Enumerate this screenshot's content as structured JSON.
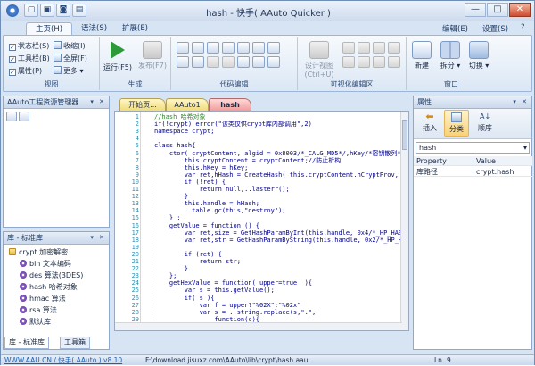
{
  "window": {
    "title": "hash - 快手( AAuto Quicker )",
    "min": "—",
    "max": "□",
    "close": "✕"
  },
  "ribbon_tabs": [
    "主页(H)",
    "语法(S)",
    "扩展(E)"
  ],
  "ribbon_menus": {
    "edit": "编辑(E)",
    "settings": "设置(S)",
    "help": "?"
  },
  "view_group": {
    "label": "视图",
    "items": [
      "状态栏(S)",
      "工具栏(B)",
      "属性(P)",
      "收缩(I)",
      "全屏(F)",
      "更多"
    ]
  },
  "generate_group": {
    "label": "生成",
    "run": "运行(F5)",
    "publish": "发布(F7)"
  },
  "code_group": {
    "label": "代码编辑"
  },
  "visual_group": {
    "label": "可视化编辑区",
    "design_view": "设计视图",
    "design_shortcut": "(Ctrl+U)"
  },
  "window_group": {
    "label": "窗口",
    "new": "新建",
    "split": "拆分",
    "switch": "切换"
  },
  "project_panel": {
    "title": "AAuto工程资源管理器"
  },
  "library_panel": {
    "title": "库 - 标准库",
    "items": [
      {
        "label": "crypt 加密解密",
        "kind": "dir"
      },
      {
        "label": "bin 文本编码",
        "kind": "mod"
      },
      {
        "label": "des 算法(3DES)",
        "kind": "mod"
      },
      {
        "label": "hash 哈希对象",
        "kind": "mod"
      },
      {
        "label": "hmac 算法",
        "kind": "mod"
      },
      {
        "label": "rsa 算法",
        "kind": "mod"
      },
      {
        "label": "默认库",
        "kind": "mod"
      }
    ]
  },
  "bottom_tabs": [
    "库 - 标准库",
    "工具箱"
  ],
  "editor_tabs": [
    "开始页...",
    "AAuto1",
    "hash"
  ],
  "code_lines": [
    {
      "n": "1",
      "t": "//hash 哈希对象"
    },
    {
      "n": "2",
      "t": "if(!crypt) error(\"该类仅供crypt库内部调用\",2)"
    },
    {
      "n": "3",
      "t": "namespace crypt;"
    },
    {
      "n": "4",
      "t": ""
    },
    {
      "n": "5",
      "t": "class hash{"
    },
    {
      "n": "6",
      "t": "    ctor( cryptContent, algid = 0x8003/*_CALG_MD5*/,hKey/*密钥散列*/,"
    },
    {
      "n": "7",
      "t": "        this.cryptContent = cryptContent;//防止析构"
    },
    {
      "n": "8",
      "t": "        this.hKey = hKey;"
    },
    {
      "n": "9",
      "t": "        var ret,hHash = CreateHash( this.cryptContent.hCryptProv, alg"
    },
    {
      "n": "10",
      "t": "        if (!ret) {"
    },
    {
      "n": "11",
      "t": "            return null,..lasterr();"
    },
    {
      "n": "12",
      "t": "        }"
    },
    {
      "n": "13",
      "t": "        this.handle = hHash;"
    },
    {
      "n": "14",
      "t": "        ..table.gc(this,\"destroy\");"
    },
    {
      "n": "15",
      "t": "    } ;"
    },
    {
      "n": "16",
      "t": "    getValue = function () {"
    },
    {
      "n": "17",
      "t": "        var ret,size = GetHashParamByInt(this.handle, 0x4/*_HP_HASHS"
    },
    {
      "n": "18",
      "t": "        var ret,str = GetHashParamByString(this.handle, 0x2/*_HP_HAS"
    },
    {
      "n": "19",
      "t": ""
    },
    {
      "n": "20",
      "t": "        if (ret) {"
    },
    {
      "n": "21",
      "t": "            return str;"
    },
    {
      "n": "22",
      "t": "        }"
    },
    {
      "n": "23",
      "t": "    };"
    },
    {
      "n": "24",
      "t": "    getHexValue = function( upper=true  ){"
    },
    {
      "n": "25",
      "t": "        var s = this.getValue();"
    },
    {
      "n": "26",
      "t": "        if( s ){"
    },
    {
      "n": "27",
      "t": "            var f = upper?\"%02X\":\"%02x\""
    },
    {
      "n": "28",
      "t": "            var s = ..string.replace(s,\".\","
    },
    {
      "n": "29",
      "t": "                function(c){"
    }
  ],
  "prop_panel": {
    "title": "属性",
    "buttons": [
      "插入",
      "分类",
      "顺序"
    ],
    "object": "hash",
    "headers": [
      "Property",
      "Value"
    ],
    "rows": [
      {
        "k": "库路径",
        "v": "crypt.hash"
      }
    ]
  },
  "status": {
    "link": "WWW.AAU.CN / 快手( AAuto ) v8.10",
    "path": "F:\\download.jisuxz.com\\AAuto\\lib\\crypt\\hash.aau",
    "cursor_label": "Ln",
    "cursor_value": "9"
  },
  "colors": {
    "accent": "#2a5fae",
    "tab_active": "#f29c9c",
    "tab_normal": "#f0dc78"
  }
}
